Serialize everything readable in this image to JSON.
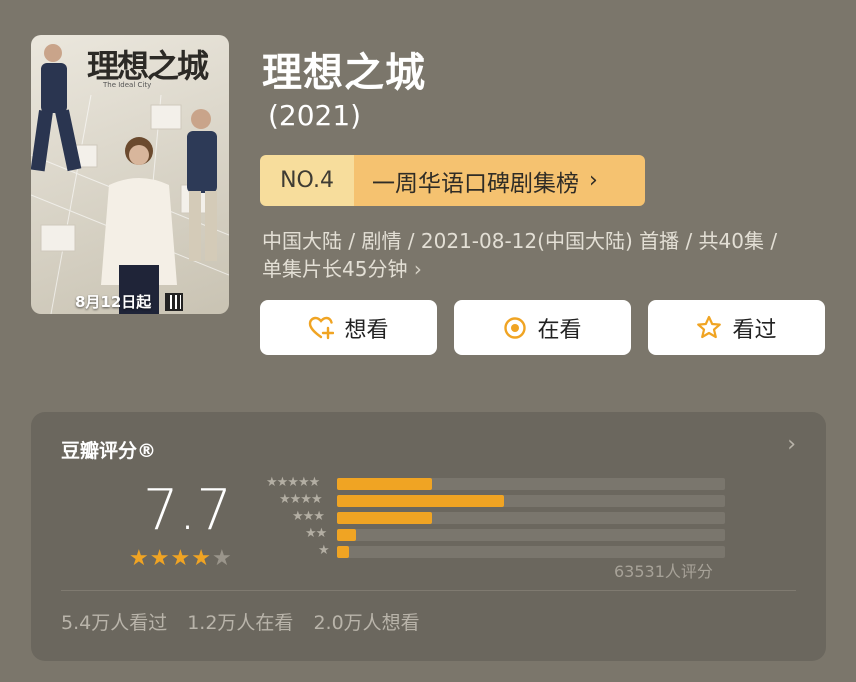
{
  "poster": {
    "title": "理想之城",
    "subtitle": "The Ideal City",
    "date_text": "8月12日起"
  },
  "title": "理想之城",
  "year": "(2021)",
  "ranking": {
    "number": "NO.4",
    "label": "一周华语口碑剧集榜",
    "chevron": "›"
  },
  "meta": {
    "line1": "中国大陆 / 剧情 / 2021-08-12(中国大陆) 首播 / 共40集 /",
    "line2": "单集片长45分钟",
    "chevron": "›"
  },
  "actions": [
    {
      "label": "想看",
      "icon": "heart-plus-icon"
    },
    {
      "label": "在看",
      "icon": "circle-dot-icon"
    },
    {
      "label": "看过",
      "icon": "star-outline-icon"
    }
  ],
  "rating": {
    "title": "豆瓣评分®",
    "chevron": "›",
    "score": "7.7",
    "stars_filled": 4,
    "stars_total": 5,
    "distribution": [
      {
        "stars": 5,
        "fraction": 0.245
      },
      {
        "stars": 4,
        "fraction": 0.43
      },
      {
        "stars": 3,
        "fraction": 0.245
      },
      {
        "stars": 2,
        "fraction": 0.05
      },
      {
        "stars": 1,
        "fraction": 0.03
      }
    ],
    "total_text": "63531人评分",
    "stats": [
      "5.4万人看过",
      "1.2万人在看",
      "2.0万人想看"
    ]
  },
  "colors": {
    "background": "#7b766b",
    "card": "#6b675e",
    "accent": "#f0a423",
    "rank_left": "#f7dd9c",
    "rank_right": "#f5c270"
  }
}
